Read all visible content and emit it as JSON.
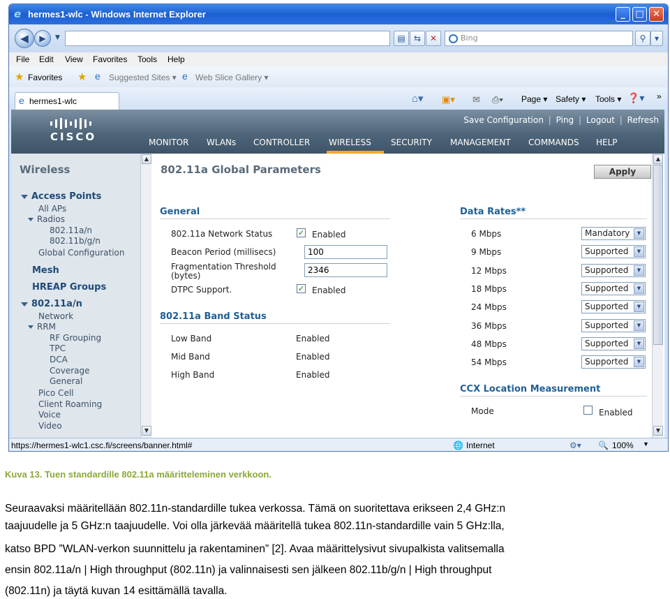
{
  "window": {
    "title": "hermes1-wlc - Windows Internet Explorer"
  },
  "browser": {
    "search_placeholder": "Bing",
    "menu": [
      "File",
      "Edit",
      "View",
      "Favorites",
      "Tools",
      "Help"
    ],
    "favorites": {
      "label": "Favorites",
      "suggested": "Suggested Sites ▾",
      "webslice": "Web Slice Gallery ▾"
    },
    "tab": {
      "title": "hermes1-wlc"
    },
    "toolbar": {
      "page": "Page ▾",
      "safety": "Safety ▾",
      "tools": "Tools ▾"
    },
    "status": {
      "url": "https://hermes1-wlc1.csc.fi/screens/banner.html#",
      "zone": "Internet",
      "zoom": "100%"
    }
  },
  "cisco": {
    "toplinks": {
      "save": "Save Configuration",
      "ping": "Ping",
      "logout": "Logout",
      "refresh": "Refresh"
    },
    "logo": "CISCO",
    "nav": [
      "MONITOR",
      "WLANs",
      "CONTROLLER",
      "WIRELESS",
      "SECURITY",
      "MANAGEMENT",
      "COMMANDS",
      "HELP"
    ],
    "sidebar": {
      "title": "Wireless",
      "items": [
        "Access Points",
        "All APs",
        "Radios",
        "802.11a/n",
        "802.11b/g/n",
        "Global Configuration",
        "Mesh",
        "HREAP Groups",
        "802.11a/n",
        "Network",
        "RRM",
        "RF Grouping",
        "TPC",
        "DCA",
        "Coverage",
        "General",
        "Pico Cell",
        "Client Roaming",
        "Voice",
        "Video"
      ]
    },
    "content": {
      "title": "802.11a Global Parameters",
      "apply": "Apply",
      "general": {
        "heading": "General",
        "network_status_label": "802.11a Network Status",
        "network_status_value": "Enabled",
        "beacon_label": "Beacon Period (millisecs)",
        "beacon_value": "100",
        "frag_label_1": "Fragmentation Threshold",
        "frag_label_2": "(bytes)",
        "frag_value": "2346",
        "dtpc_label": "DTPC Support.",
        "dtpc_value": "Enabled"
      },
      "band_status": {
        "heading": "802.11a Band Status",
        "rows": [
          {
            "label": "Low Band",
            "value": "Enabled"
          },
          {
            "label": "Mid Band",
            "value": "Enabled"
          },
          {
            "label": "High Band",
            "value": "Enabled"
          }
        ]
      },
      "data_rates": {
        "heading": "Data Rates**",
        "rows": [
          {
            "rate": "6 Mbps",
            "value": "Mandatory"
          },
          {
            "rate": "9 Mbps",
            "value": "Supported"
          },
          {
            "rate": "12 Mbps",
            "value": "Supported"
          },
          {
            "rate": "18 Mbps",
            "value": "Supported"
          },
          {
            "rate": "24 Mbps",
            "value": "Supported"
          },
          {
            "rate": "36 Mbps",
            "value": "Supported"
          },
          {
            "rate": "48 Mbps",
            "value": "Supported"
          },
          {
            "rate": "54 Mbps",
            "value": "Supported"
          }
        ]
      },
      "ccx": {
        "heading": "CCX Location Measurement",
        "mode_label": "Mode",
        "mode_value": "Enabled"
      }
    }
  },
  "article": {
    "caption": "Kuva 13. Tuen standardille 802.11a määritteleminen verkkoon.",
    "lines": [
      "Seuraavaksi määritellään 802.11n-standardille tukea verkossa. Tämä on suoritettava erikseen 2,4 GHz:n",
      "taajuudelle ja 5 GHz:n taajuudelle. Voi olla järkevää määritellä tukea 802.11n-standardille vain 5 GHz:lla,",
      "katso BPD ”WLAN-verkon suunnittelu ja rakentaminen” [2]. Avaa määrittelysivut sivupalkista valitsemalla",
      "ensin 802.11a/n  |  High throughput (802.11n) ja valinnaisesti sen jälkeen 802.11b/g/n  |  High throughput",
      "(802.11n) ja täytä kuvan 14 esittämällä tavalla."
    ]
  }
}
